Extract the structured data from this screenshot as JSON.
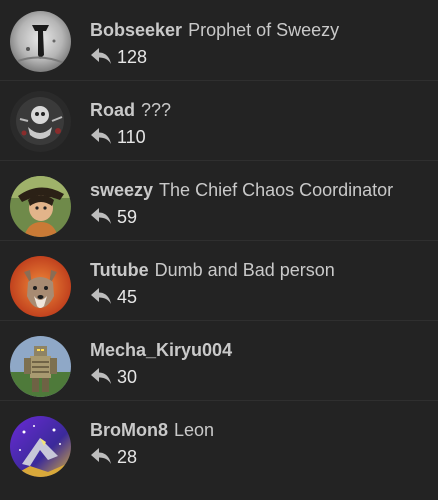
{
  "users": [
    {
      "username": "Bobseeker",
      "title": "Prophet of Sweezy",
      "count": "128",
      "avatar": "bobseeker-avatar"
    },
    {
      "username": "Road",
      "title": "???",
      "count": "110",
      "avatar": "road-avatar"
    },
    {
      "username": "sweezy",
      "title": "The Chief Chaos Coordinator",
      "count": "59",
      "avatar": "sweezy-avatar"
    },
    {
      "username": "Tutube",
      "title": "Dumb and Bad person",
      "count": "45",
      "avatar": "tutube-avatar"
    },
    {
      "username": "Mecha_Kiryu004",
      "title": "",
      "count": "30",
      "avatar": "mecha-kiryu-avatar"
    },
    {
      "username": "BroMon8",
      "title": "Leon",
      "count": "28",
      "avatar": "bromon8-avatar"
    }
  ],
  "icons": {
    "reply": "reply-arrow-icon"
  },
  "colors": {
    "background": "#232323",
    "text": "#c9c9c9",
    "count_text": "#e6e6e6",
    "icon": "#bdbdbd"
  }
}
